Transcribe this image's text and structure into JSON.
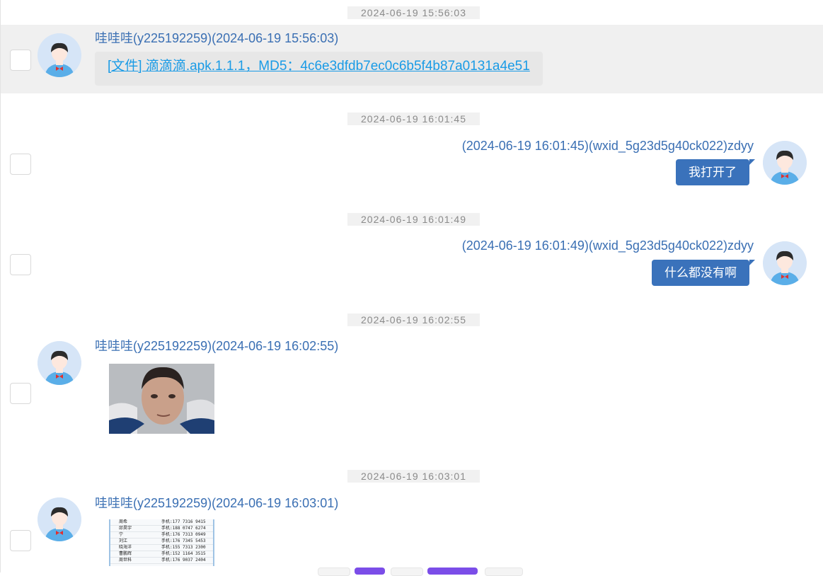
{
  "messages": [
    {
      "timestamp": "2024-06-19 15:56:03",
      "sender": "哇哇哇(y225192259)(2024-06-19 15:56:03)",
      "side": "left",
      "type": "file",
      "file_link": "[文件] 滴滴滴.apk.1.1.1，MD5：4c6e3dfdb7ec0c6b5f4b87a0131a4e51"
    },
    {
      "timestamp": "2024-06-19 16:01:45",
      "sender": "(2024-06-19 16:01:45)(wxid_5g23d5g40ck022)zdyy",
      "side": "right",
      "type": "text",
      "text": "我打开了"
    },
    {
      "timestamp": "2024-06-19 16:01:49",
      "sender": "(2024-06-19 16:01:49)(wxid_5g23d5g40ck022)zdyy",
      "side": "right",
      "type": "text",
      "text": "什么都没有啊"
    },
    {
      "timestamp": "2024-06-19 16:02:55",
      "sender": "哇哇哇(y225192259)(2024-06-19 16:02:55)",
      "side": "left",
      "type": "image"
    },
    {
      "timestamp": "2024-06-19 16:03:01",
      "sender": "哇哇哇(y225192259)(2024-06-19 16:03:01)",
      "side": "left",
      "type": "image",
      "image_rows": [
        {
          "name": "周希",
          "phone": "手机:177 7316 9415"
        },
        {
          "name": "邱昊宇",
          "phone": "手机:188 0747 6274"
        },
        {
          "name": "宁",
          "phone": "手机:176 7313 0949"
        },
        {
          "name": "刘江",
          "phone": "手机:176 7345 5453"
        },
        {
          "name": "晓海洋",
          "phone": "手机:155 7313 2300"
        },
        {
          "name": "曹鹏辉",
          "phone": "手机:152 1164 3515"
        },
        {
          "name": "周世科",
          "phone": "手机:176 9037 2404"
        }
      ]
    }
  ],
  "colors": {
    "sender_text": "#3a6fb3",
    "bubble": "#3a72bb",
    "file_link": "#1a9be6",
    "highlight_row": "#f0f0f0",
    "pager_accent": "#7b4de8"
  },
  "icons": [
    "user-avatar-icon",
    "checkbox-icon"
  ]
}
